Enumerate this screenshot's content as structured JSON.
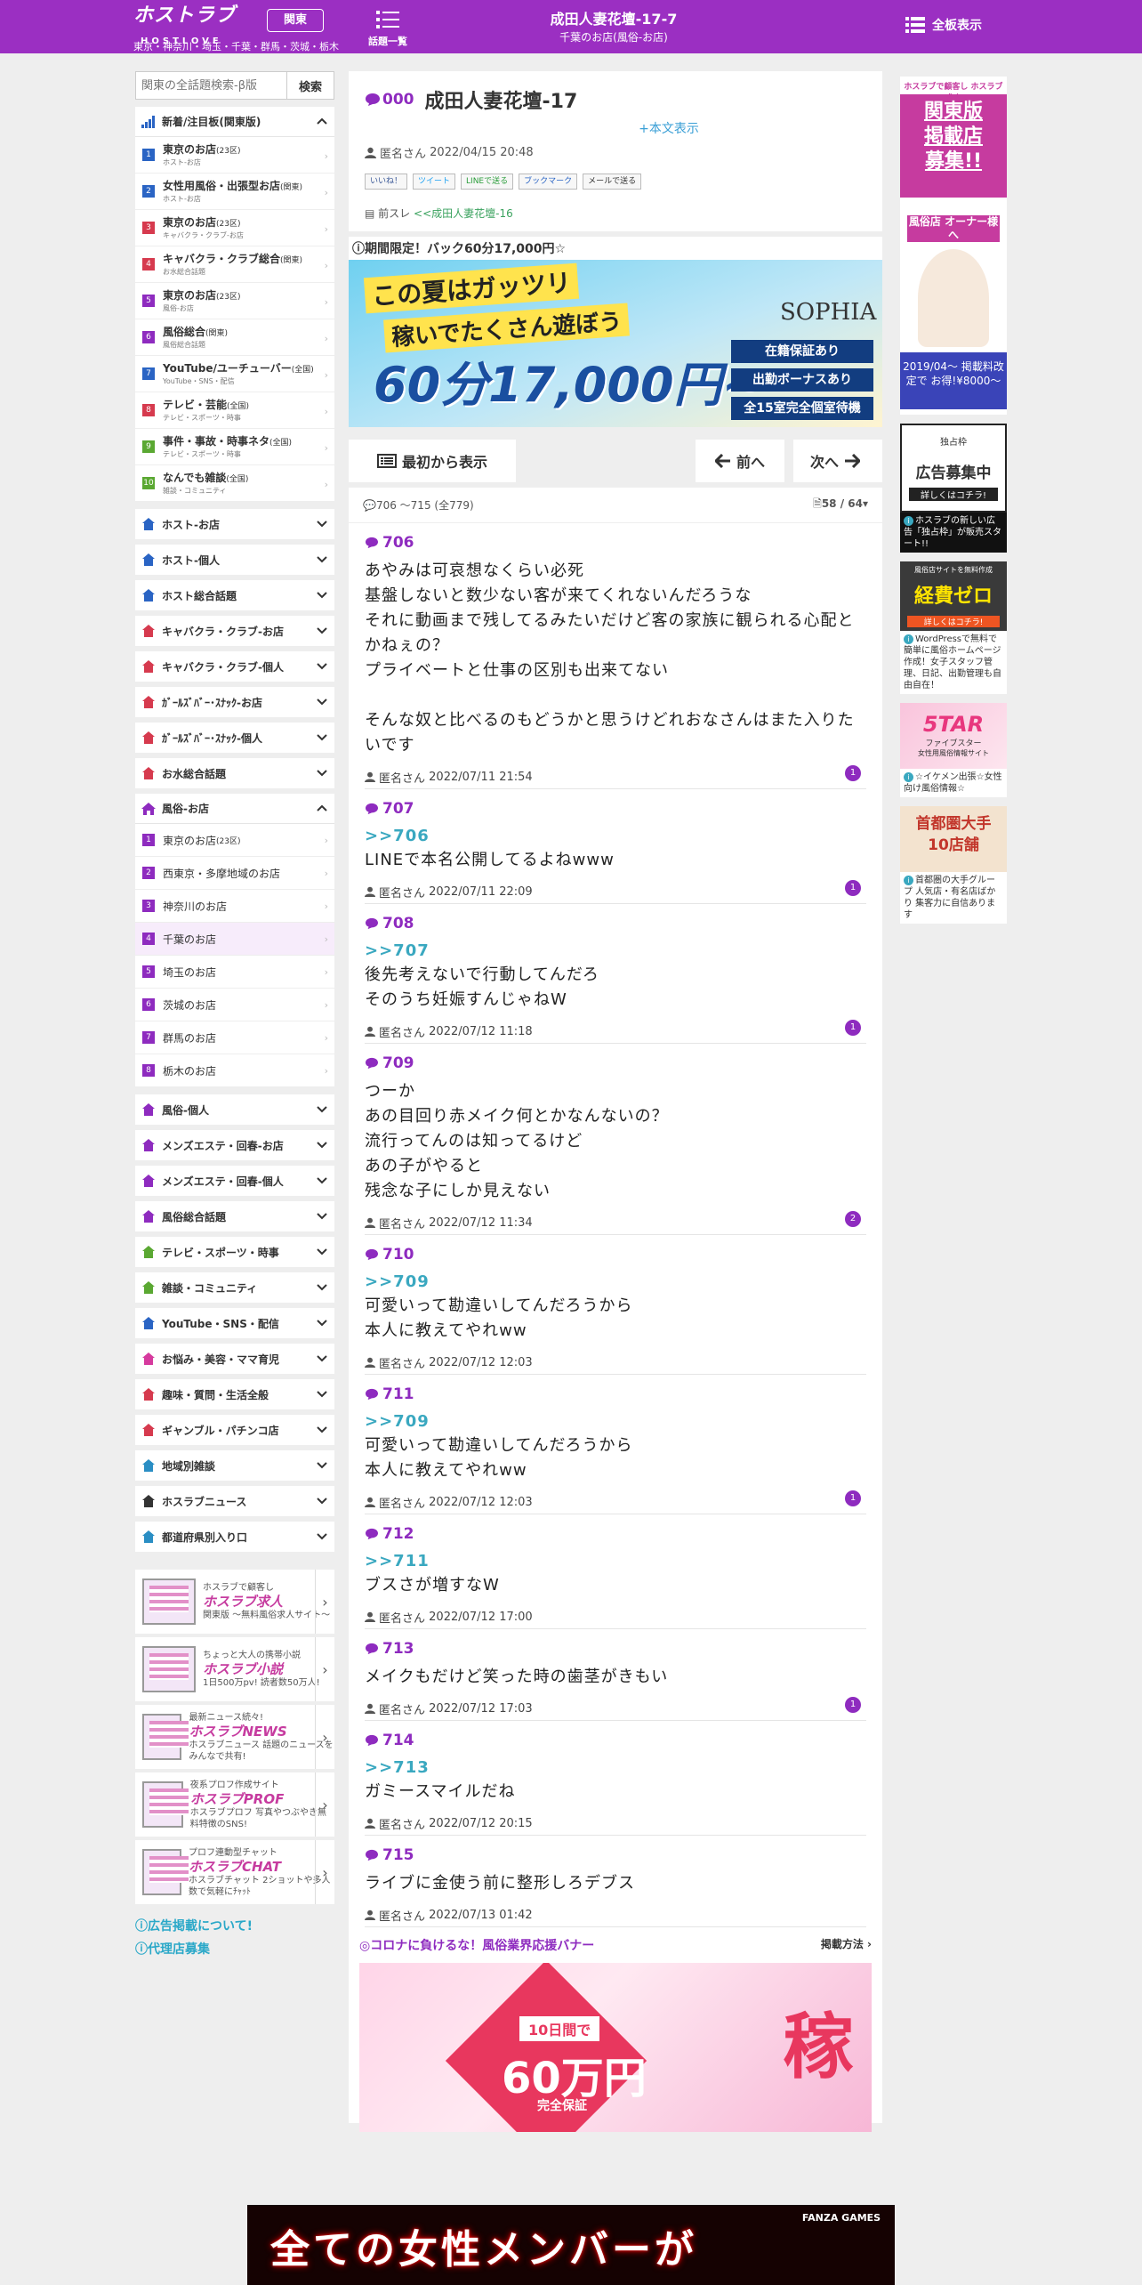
{
  "header": {
    "logo_main": "ホストラブ",
    "logo_sub": "HOSTLOVE",
    "regions": "東京・神奈川・埼玉・千葉・群馬・茨城・栃木",
    "region_button": "関東",
    "topics_label": "話題一覧",
    "thread_title": "成田人妻花壇-17-7",
    "thread_subtitle": "千葉のお店(風俗-お店)",
    "full_display": "全板表示"
  },
  "search": {
    "placeholder": "関東の全話題検索-β版",
    "button": "検索"
  },
  "sidebar": {
    "featured_title": "新着/注目板(関東版)",
    "featured": [
      {
        "num": "1",
        "color": "#2a64c4",
        "label": "東京のお店",
        "tag": "(23区)",
        "desc": "ホスト-お店"
      },
      {
        "num": "2",
        "color": "#2a64c4",
        "label": "女性用風俗・出張型お店",
        "tag": "(関東)",
        "desc": "ホスト-お店"
      },
      {
        "num": "3",
        "color": "#d63a4e",
        "label": "東京のお店",
        "tag": "(23区)",
        "desc": "キャバクラ・クラブ-お店"
      },
      {
        "num": "4",
        "color": "#d63a4e",
        "label": "キャバクラ・クラブ総合",
        "tag": "(関東)",
        "desc": "お水総合話題"
      },
      {
        "num": "5",
        "color": "#8e2bbf",
        "label": "東京のお店",
        "tag": "(23区)",
        "desc": "風俗-お店"
      },
      {
        "num": "6",
        "color": "#8e2bbf",
        "label": "風俗総合",
        "tag": "(関東)",
        "desc": "風俗総合話題"
      },
      {
        "num": "7",
        "color": "#2a64c4",
        "label": "YouTube/ユーチューバー",
        "tag": "(全国)",
        "desc": "YouTube・SNS・配信"
      },
      {
        "num": "8",
        "color": "#d63a4e",
        "label": "テレビ・芸能",
        "tag": "(全国)",
        "desc": "テレビ・スポーツ・時事"
      },
      {
        "num": "9",
        "color": "#5aa832",
        "label": "事件・事故・時事ネタ",
        "tag": "(全国)",
        "desc": "テレビ・スポーツ・時事"
      },
      {
        "num": "10",
        "color": "#5aa832",
        "label": "なんでも雑談",
        "tag": "(全国)",
        "desc": "雑談・コミュニティ"
      }
    ],
    "categories_a": [
      {
        "label": "ホスト-お店",
        "color": "#2a64c4"
      },
      {
        "label": "ホスト-個人",
        "color": "#2a64c4"
      },
      {
        "label": "ホスト総合話題",
        "color": "#2a64c4"
      },
      {
        "label": "キャバクラ・クラブ-お店",
        "color": "#d63a4e"
      },
      {
        "label": "キャバクラ・クラブ-個人",
        "color": "#d63a4e"
      },
      {
        "label": "ｶﾞｰﾙｽﾞﾊﾞｰ･ｽﾅｯｸ-お店",
        "color": "#d63a4e"
      },
      {
        "label": "ｶﾞｰﾙｽﾞﾊﾞｰ･ｽﾅｯｸ-個人",
        "color": "#d63a4e"
      },
      {
        "label": "お水総合話題",
        "color": "#d63a4e"
      }
    ],
    "fuzoku_header": "風俗-お店",
    "fuzoku_subs": [
      {
        "num": "1",
        "label": "東京のお店",
        "tag": "(23区)"
      },
      {
        "num": "2",
        "label": "西東京・多摩地域のお店",
        "tag": ""
      },
      {
        "num": "3",
        "label": "神奈川のお店",
        "tag": ""
      },
      {
        "num": "4",
        "label": "千葉のお店",
        "tag": ""
      },
      {
        "num": "5",
        "label": "埼玉のお店",
        "tag": ""
      },
      {
        "num": "6",
        "label": "茨城のお店",
        "tag": ""
      },
      {
        "num": "7",
        "label": "群馬のお店",
        "tag": ""
      },
      {
        "num": "8",
        "label": "栃木のお店",
        "tag": ""
      }
    ],
    "categories_b": [
      {
        "label": "風俗-個人",
        "color": "#8e2bbf"
      },
      {
        "label": "メンズエステ・回春-お店",
        "color": "#8e2bbf"
      },
      {
        "label": "メンズエステ・回春-個人",
        "color": "#8e2bbf"
      },
      {
        "label": "風俗総合話題",
        "color": "#8e2bbf"
      },
      {
        "label": "テレビ・スポーツ・時事",
        "color": "#5aa832"
      },
      {
        "label": "雑談・コミュニティ",
        "color": "#5aa832"
      },
      {
        "label": "YouTube・SNS・配信",
        "color": "#2a64c4"
      },
      {
        "label": "お悩み・美容・ママ育児",
        "color": "#d63a9e"
      },
      {
        "label": "趣味・質問・生活全般",
        "color": "#d63a4e"
      },
      {
        "label": "ギャンブル・パチンコ店",
        "color": "#d63a4e"
      },
      {
        "label": "地域別雑談",
        "color": "#2a8ec4"
      },
      {
        "label": "ホスラブニュース",
        "color": "#333333"
      },
      {
        "label": "都道府県別入り口",
        "color": "#2a8ec4"
      }
    ],
    "promos": [
      {
        "top": "ホスラブで顧客し",
        "brand": "ホスラブ求人",
        "bottom": "関東版 〜無料風俗求人サイト〜"
      },
      {
        "top": "ちょっと大人の携帯小説",
        "brand": "ホスラブ小説",
        "bottom": "1日500万pv! 読者数50万人!"
      },
      {
        "top": "最新ニュース続々!",
        "brand": "ホスラブNEWS",
        "bottom": "ホスラブニュース 話題のニュースをみんなで共有!"
      },
      {
        "top": "夜系プロフ作成サイト",
        "brand": "ホスラブPROF",
        "bottom": "ホスラブプロフ 写真やつぶやき無料特徴のSNS!"
      },
      {
        "top": "プロフ連動型チャット",
        "brand": "ホスラブCHAT",
        "bottom": "ホスラブチャット 2ショットや多人数で気軽にﾁｬｯﾄ"
      }
    ],
    "links": [
      "広告掲載について!",
      "代理店募集"
    ]
  },
  "thread": {
    "no": "000",
    "title": "成田人妻花壇-17",
    "expand": "+本文表示",
    "author": "匿名さん",
    "date": "2022/04/15 20:48",
    "shares": [
      "いいね！",
      "ツイート",
      "LINEで送る",
      "ブックマーク",
      "メールで送る"
    ],
    "prev_label": "前スレ",
    "prev_link": "<<成田人妻花壇-16"
  },
  "ad": {
    "title": "期間限定！バック60分17,000円☆",
    "line1": "この夏はガッツリ",
    "line2": "稼いでたくさん遊ぼう",
    "price": "60分17,000円~",
    "brand": "SOPHIA",
    "tag1": "在籍保証あり",
    "tag2": "出勤ボーナスあり",
    "tag3": "全15室完全個室待機"
  },
  "nav": {
    "first": "最初から表示",
    "prev": "前へ",
    "next": "次へ"
  },
  "posts_head": {
    "range": "706 ～715",
    "total": "(全779)",
    "page": "58 / 64"
  },
  "posts": [
    {
      "no": "706",
      "anchor": "",
      "body": "あやみは可哀想なくらい必死\n基盤しないと数少ない客が来てくれないんだろうな\nそれに動画まで残してるみたいだけど客の家族に観られる心配とかねぇの？\nプライベートと仕事の区別も出来てない\n\nそんな奴と比べるのもどうかと思うけどれおなさんはまた入りたいです",
      "author": "匿名さん",
      "date": "2022/07/11 21:54",
      "count": "1"
    },
    {
      "no": "707",
      "anchor": ">>706",
      "body": "LINEで本名公開してるよねwww",
      "author": "匿名さん",
      "date": "2022/07/11 22:09",
      "count": "1"
    },
    {
      "no": "708",
      "anchor": ">>707",
      "body": "後先考えないで行動してんだろ\nそのうち妊娠すんじゃねW",
      "author": "匿名さん",
      "date": "2022/07/12 11:18",
      "count": "1"
    },
    {
      "no": "709",
      "anchor": "",
      "body": "つーか\nあの目回り赤メイク何とかなんないの？\n流行ってんのは知ってるけど\nあの子がやると\n残念な子にしか見えない",
      "author": "匿名さん",
      "date": "2022/07/12 11:34",
      "count": "2"
    },
    {
      "no": "710",
      "anchor": ">>709",
      "body": "可愛いって勘違いしてんだろうから\n本人に教えてやれww",
      "author": "匿名さん",
      "date": "2022/07/12 12:03",
      "count": ""
    },
    {
      "no": "711",
      "anchor": ">>709",
      "body": "可愛いって勘違いしてんだろうから\n本人に教えてやれww",
      "author": "匿名さん",
      "date": "2022/07/12 12:03",
      "count": "1"
    },
    {
      "no": "712",
      "anchor": ">>711",
      "body": "ブスさが増すなW",
      "author": "匿名さん",
      "date": "2022/07/12 17:00",
      "count": ""
    },
    {
      "no": "713",
      "anchor": "",
      "body": "メイクもだけど笑った時の歯茎がきもい",
      "author": "匿名さん",
      "date": "2022/07/12 17:03",
      "count": "1"
    },
    {
      "no": "714",
      "anchor": ">>713",
      "body": "ガミースマイルだね",
      "author": "匿名さん",
      "date": "2022/07/12 20:15",
      "count": ""
    },
    {
      "no": "715",
      "anchor": "",
      "body": "ライブに金使う前に整形しろデブス",
      "author": "匿名さん",
      "date": "2022/07/13 01:42",
      "count": ""
    }
  ],
  "corona": {
    "title": "◎コロナに負けるな！風俗業界応援バナー",
    "link": "掲載方法",
    "sub": "10日間で",
    "amount": "60万円",
    "guarantee": "完全保証",
    "big": "稼"
  },
  "right_ads": [
    {
      "big": "関東版\n掲載店\n募集!!",
      "top": "ホスラブで顧客し ホスラブ求人",
      "mid": "風俗店 オーナー様へ",
      "bottom": "2019/04〜 掲載料改定で お得!¥8000〜",
      "text": ""
    },
    {
      "big": "広告募集中",
      "top": "独占枠",
      "mid": "詳しくはコチラ!",
      "bottom": "",
      "text": "ホスラブの新しい広告「独占枠」が販売スタート!!"
    },
    {
      "big": "経費ゼロ",
      "top": "風俗店サイトを無料作成",
      "mid": "詳しくはコチラ!",
      "bottom": "",
      "text": "WordPressで無料で簡単に風俗ホームページ作成！女子スタッフ管理、日記、出勤管理も自由自在！"
    },
    {
      "big": "5TAR",
      "top": "ファイブスター",
      "mid": "女性用風俗情報サイト",
      "bottom": "",
      "text": "☆イケメン出張☆女性向け風俗情報☆"
    },
    {
      "big": "首都圏大手\n10店舗",
      "top": "",
      "mid": "",
      "bottom": "",
      "text": "首都圏の大手グループ 人気店・有名店ばかり 集客力に自信あります"
    }
  ],
  "bottom_ad": {
    "text": "全ての女性メンバーが",
    "brand": "FANZA GAMES"
  }
}
